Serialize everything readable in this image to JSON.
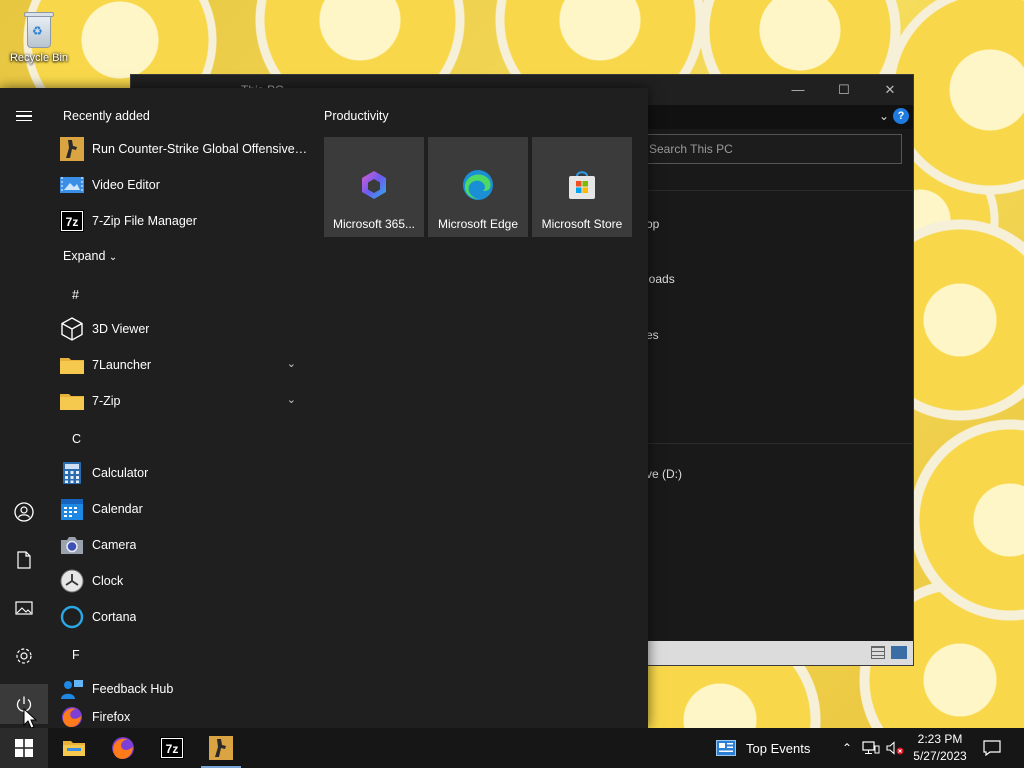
{
  "desktop": {
    "icons": [
      {
        "label": "Recycle Bin",
        "icon": "recycle-bin-icon"
      }
    ]
  },
  "explorer": {
    "title": "This PC",
    "search_placeholder": "Search This PC",
    "visible_items": [
      "op",
      "loads",
      "es",
      "ve (D:)"
    ]
  },
  "start_menu": {
    "recently_added_label": "Recently added",
    "recent_apps": [
      {
        "name": "Run Counter-Strike Global Offensive [...",
        "icon": "csgo-icon"
      },
      {
        "name": "Video Editor",
        "icon": "video-editor-icon"
      },
      {
        "name": "7-Zip File Manager",
        "icon": "7zip-icon"
      }
    ],
    "expand_label": "Expand",
    "groups": [
      {
        "letter": "#",
        "apps": [
          {
            "name": "3D Viewer",
            "icon": "cube-icon",
            "folder": false
          },
          {
            "name": "7Launcher",
            "icon": "folder-icon",
            "folder": true
          },
          {
            "name": "7-Zip",
            "icon": "folder-icon",
            "folder": true
          }
        ]
      },
      {
        "letter": "C",
        "apps": [
          {
            "name": "Calculator",
            "icon": "calculator-icon",
            "folder": false
          },
          {
            "name": "Calendar",
            "icon": "calendar-icon",
            "folder": false
          },
          {
            "name": "Camera",
            "icon": "camera-icon",
            "folder": false
          },
          {
            "name": "Clock",
            "icon": "clock-icon",
            "folder": false
          },
          {
            "name": "Cortana",
            "icon": "cortana-icon",
            "folder": false
          }
        ]
      },
      {
        "letter": "F",
        "apps": [
          {
            "name": "Feedback Hub",
            "icon": "feedback-hub-icon",
            "folder": false
          },
          {
            "name": "Firefox",
            "icon": "firefox-icon",
            "folder": false
          }
        ]
      }
    ],
    "tiles_group_label": "Productivity",
    "tiles": [
      {
        "name": "Microsoft 365...",
        "icon": "microsoft-365-icon"
      },
      {
        "name": "Microsoft Edge",
        "icon": "edge-icon"
      },
      {
        "name": "Microsoft Store",
        "icon": "store-icon"
      }
    ],
    "rail": [
      "menu-icon",
      "user-icon",
      "document-icon",
      "pictures-icon",
      "settings-icon",
      "power-icon"
    ]
  },
  "taskbar": {
    "pinned": [
      "file-explorer-icon",
      "firefox-icon",
      "7zip-icon",
      "csgo-icon"
    ],
    "news_label": "Top Events",
    "time": "2:23 PM",
    "date": "5/27/2023"
  },
  "colors": {
    "start_bg": "#1f1f1f",
    "tile_bg": "#3b3b3b",
    "taskbar_bg": "#161616",
    "accent": "#1e7ce0"
  }
}
